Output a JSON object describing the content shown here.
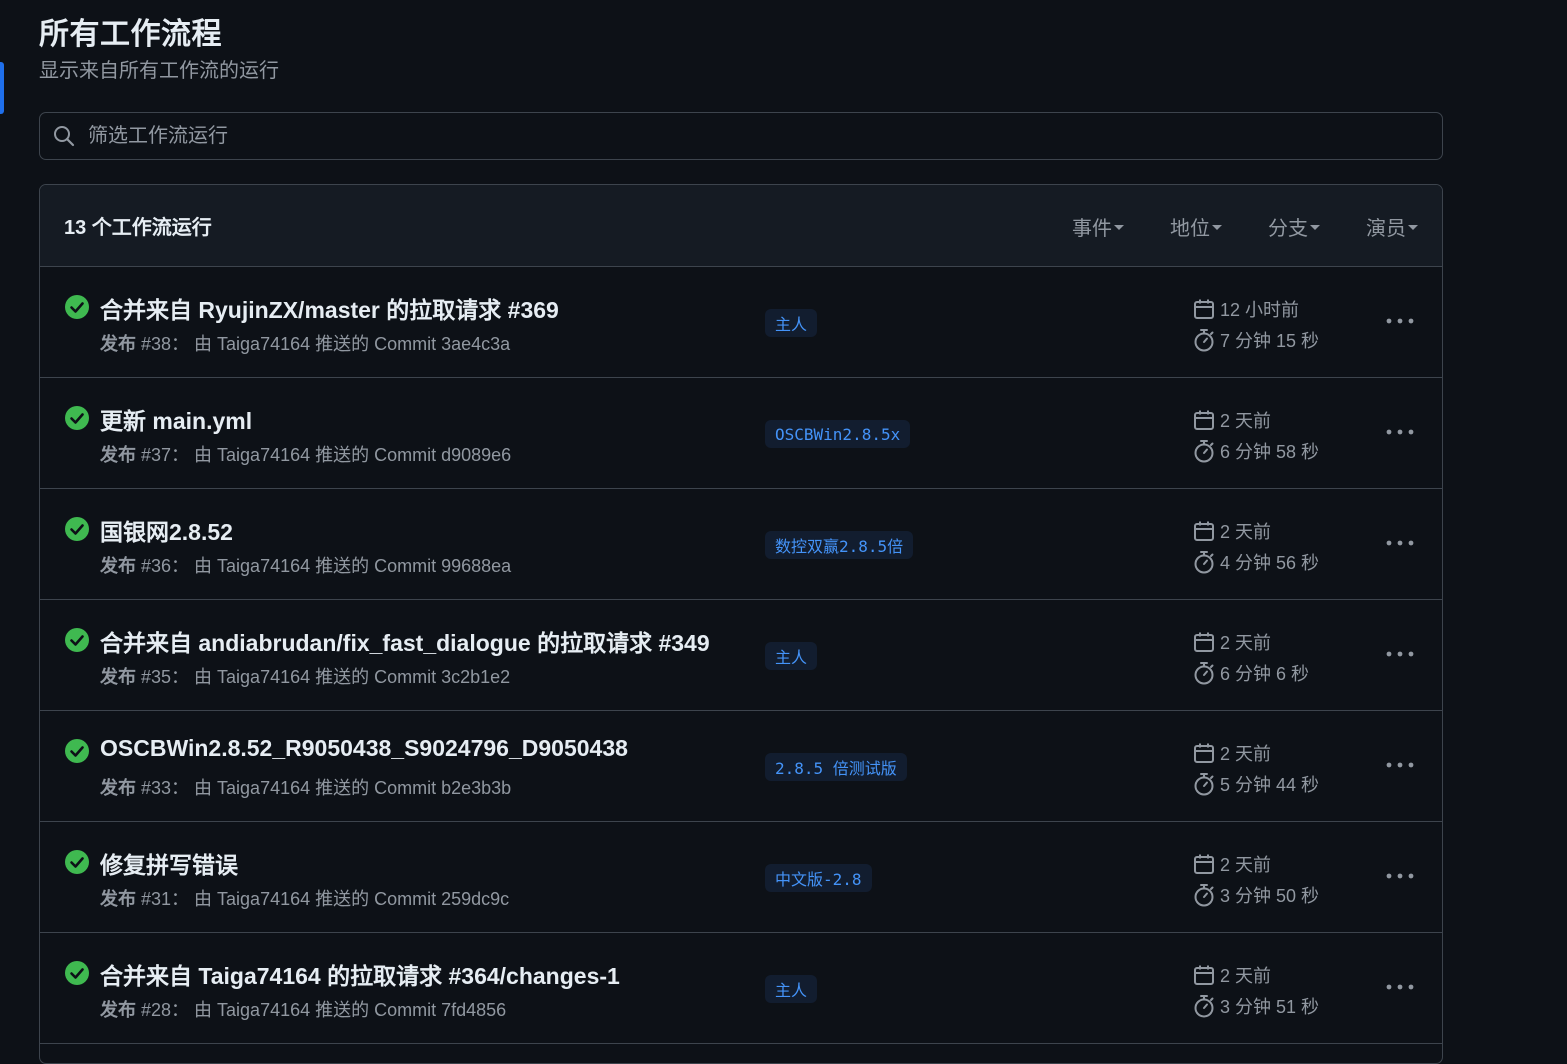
{
  "page": {
    "title": "所有工作流程",
    "subtitle": "显示来自所有工作流的运行"
  },
  "search": {
    "placeholder": "筛选工作流运行",
    "icon": "search-icon"
  },
  "runs_header": {
    "count_label": "13 个工作流运行",
    "filters": [
      "事件",
      "地位",
      "分支",
      "演员"
    ]
  },
  "runs": [
    {
      "title": "合并来自 RyujinZX/master 的拉取请求 #369",
      "workflow": "发布",
      "meta": " #38：  由 Taiga74164 推送的 Commit 3ae4c3a",
      "branch": "主人",
      "date": "12 小时前",
      "duration": "7 分钟 15 秒",
      "status": "success"
    },
    {
      "title": "更新 main.yml",
      "workflow": "发布",
      "meta": " #37：  由 Taiga74164 推送的 Commit d9089e6",
      "branch": "OSCBWin2.8.5x",
      "date": "2 天前",
      "duration": "6 分钟 58 秒",
      "status": "success"
    },
    {
      "title": "国银网2.8.52",
      "workflow": "发布",
      "meta": " #36：  由 Taiga74164 推送的 Commit 99688ea",
      "branch": "数控双赢2.8.5倍",
      "date": "2 天前",
      "duration": "4 分钟 56 秒",
      "status": "success"
    },
    {
      "title": "合并来自 andiabrudan/fix_fast_dialogue 的拉取请求 #349",
      "workflow": "发布",
      "meta": " #35：  由 Taiga74164 推送的 Commit 3c2b1e2",
      "branch": "主人",
      "date": "2 天前",
      "duration": "6 分钟 6 秒",
      "status": "success"
    },
    {
      "title": "OSCBWin2.8.52_R9050438_S9024796_D9050438",
      "workflow": "发布",
      "meta": " #33：  由 Taiga74164 推送的 Commit b2e3b3b",
      "branch": "2.8.5 倍测试版",
      "date": "2 天前",
      "duration": "5 分钟 44 秒",
      "status": "success"
    },
    {
      "title": "修复拼写错误",
      "workflow": "发布",
      "meta": " #31：  由 Taiga74164 推送的 Commit 259dc9c",
      "branch": "中文版-2.8",
      "date": "2 天前",
      "duration": "3 分钟 50 秒",
      "status": "success"
    },
    {
      "title": "合并来自 Taiga74164 的拉取请求 #364/changes-1",
      "workflow": "发布",
      "meta": " #28：  由 Taiga74164 推送的 Commit 7fd4856",
      "branch": "主人",
      "date": "2 天前",
      "duration": "3 分钟 51 秒",
      "status": "success"
    }
  ],
  "colors": {
    "background": "#0d1117",
    "header_bg": "#151b23",
    "border": "#3d444d",
    "success": "#3fb950",
    "branch_text": "#4493f8",
    "branch_bg": "#121d2f",
    "muted": "#9198a1",
    "accent": "#1f6feb"
  }
}
